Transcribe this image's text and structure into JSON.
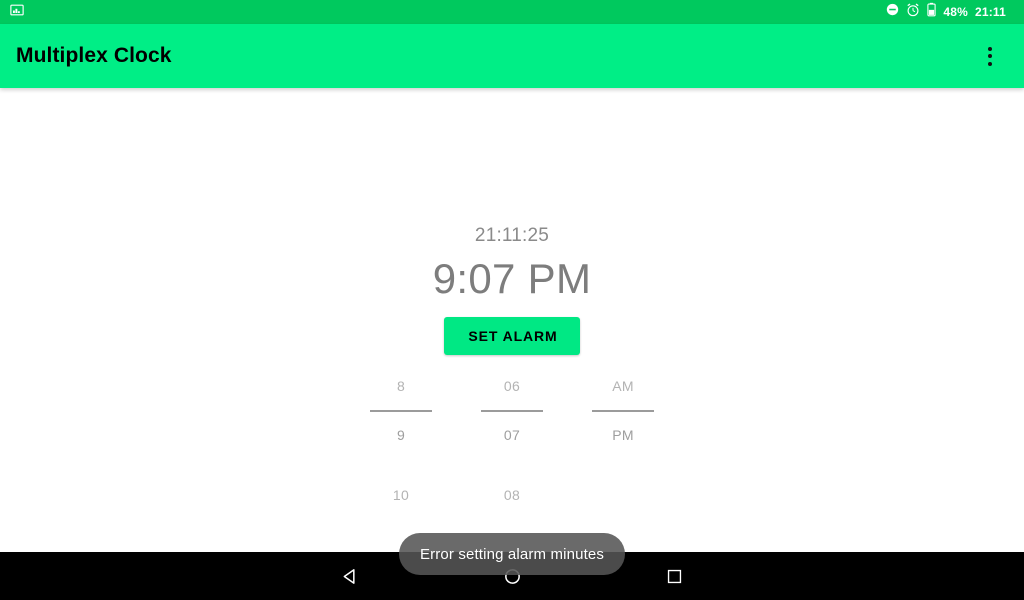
{
  "status_bar": {
    "left_icon": "screenshot-image-icon",
    "dnd_icon": "do-not-disturb-icon",
    "alarm_icon": "alarm-clock-icon",
    "battery_icon": "battery-icon",
    "battery_label": "48%",
    "clock_label": "21:11",
    "background": "#00C95E",
    "foreground": "#FFFFFF"
  },
  "app_bar": {
    "title": "Multiplex Clock",
    "overflow_icon": "more-vert-icon",
    "background": "#00EE86",
    "title_color": "#000000"
  },
  "main": {
    "system_time": "21:11:25",
    "alarm_time": "9:07 PM",
    "set_alarm_label": "SET ALARM",
    "set_alarm_color": "#00E884",
    "time_picker": {
      "columns": [
        {
          "name": "hour",
          "above": "8",
          "selected": "9",
          "below": "10"
        },
        {
          "name": "minute",
          "above": "06",
          "selected": "07",
          "below": "08"
        },
        {
          "name": "meridiem",
          "above": "AM",
          "selected": "PM",
          "below": ""
        }
      ]
    }
  },
  "toast": {
    "message": "Error setting alarm minutes",
    "background": "#555555",
    "text_color": "#FFFFFF"
  },
  "nav_bar": {
    "back_icon": "back-triangle-icon",
    "home_icon": "home-circle-icon",
    "recents_icon": "recents-square-icon",
    "background": "#000000"
  }
}
